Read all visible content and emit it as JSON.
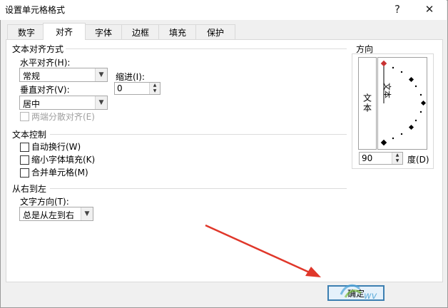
{
  "window": {
    "title": "设置单元格格式",
    "help_label": "?",
    "close_label": "✕"
  },
  "tabs": [
    {
      "label": "数字"
    },
    {
      "label": "对齐"
    },
    {
      "label": "字体"
    },
    {
      "label": "边框"
    },
    {
      "label": "填充"
    },
    {
      "label": "保护"
    }
  ],
  "active_tab": "对齐",
  "text_alignment": {
    "section_title": "文本对齐方式",
    "horizontal_label": "水平对齐(H):",
    "horizontal_value": "常规",
    "indent_label": "缩进(I):",
    "indent_value": "0",
    "vertical_label": "垂直对齐(V):",
    "vertical_value": "居中",
    "distributed_label": "两端分散对齐(E)"
  },
  "text_control": {
    "section_title": "文本控制",
    "wrap_label": "自动换行(W)",
    "shrink_label": "缩小字体填充(K)",
    "merge_label": "合并单元格(M)"
  },
  "rtl": {
    "section_title": "从右到左",
    "direction_label": "文字方向(T):",
    "direction_value": "总是从左到右"
  },
  "orientation": {
    "section_title": "方向",
    "vertical_text": "文本",
    "dial_text": "文本",
    "degree_value": "90",
    "degree_label": "度(D)"
  },
  "ok_label": "确定",
  "watermark": "wv"
}
